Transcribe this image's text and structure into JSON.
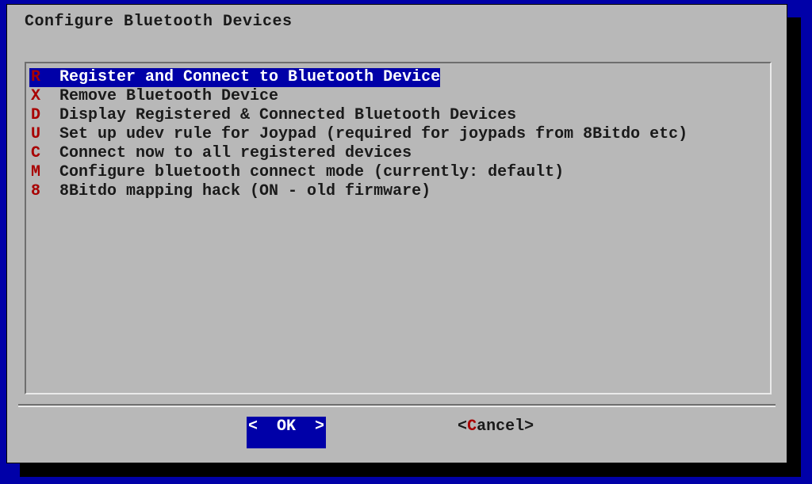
{
  "dialog": {
    "title": "Configure Bluetooth Devices"
  },
  "menu": {
    "items": [
      {
        "key": "R",
        "label": "Register and Connect to Bluetooth Device",
        "selected": true
      },
      {
        "key": "X",
        "label": "Remove Bluetooth Device",
        "selected": false
      },
      {
        "key": "D",
        "label": "Display Registered & Connected Bluetooth Devices",
        "selected": false
      },
      {
        "key": "U",
        "label": "Set up udev rule for Joypad (required for joypads from 8Bitdo etc)",
        "selected": false
      },
      {
        "key": "C",
        "label": "Connect now to all registered devices",
        "selected": false
      },
      {
        "key": "M",
        "label": "Configure bluetooth connect mode (currently: default)",
        "selected": false
      },
      {
        "key": "8",
        "label": "8Bitdo mapping hack (ON - old firmware)",
        "selected": false
      }
    ]
  },
  "buttons": {
    "ok": {
      "left_bracket": "<",
      "label": "  OK  ",
      "right_bracket": ">"
    },
    "cancel": {
      "left_bracket": "<",
      "hotkey": "C",
      "rest": "ancel",
      "right_bracket": ">"
    }
  }
}
